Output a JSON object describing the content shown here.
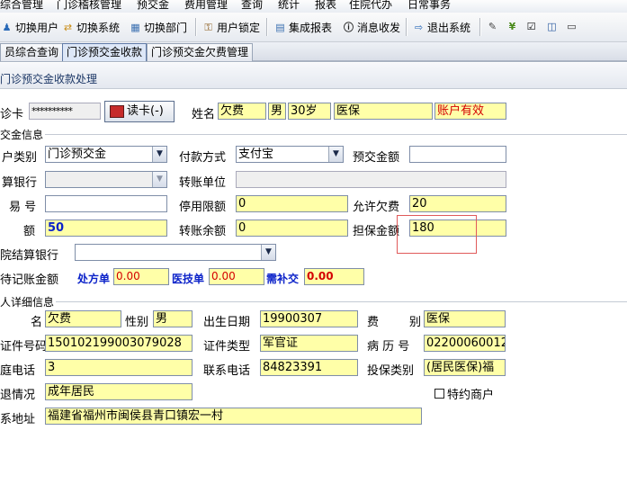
{
  "menubar": {
    "items": [
      "综合管理",
      "门诊稽核管理",
      "预交金",
      "费用管理",
      "查询",
      "统计",
      "报表",
      "住院代办",
      "日常事务"
    ]
  },
  "toolbar": {
    "switch_user": "切换用户",
    "switch_system": "切换系统",
    "switch_dept": "切换部门",
    "user_lock": "用户锁定",
    "integrated_report": "集成报表",
    "message": "消息收发",
    "exit_system": "退出系统"
  },
  "tabs": [
    "员综合查询",
    "门诊预交金收款",
    "门诊预交金欠费管理"
  ],
  "subheader": {
    "title": "门诊预交金收款处理"
  },
  "card": {
    "label": "诊卡",
    "card_no": "**********",
    "read_button": "读卡(-)",
    "name_label": "姓名",
    "name": "欠费",
    "gender": "男",
    "age": "30岁",
    "insurance": "医保",
    "account_status": "账户有效"
  },
  "payment": {
    "section_title": "交金信息",
    "account_type_label": "户类别",
    "account_type": "门诊预交金",
    "pay_method_label": "付款方式",
    "pay_method": "支付宝",
    "prepay_amount_label": "预交金额",
    "prepay_amount": "",
    "bank_label": "算银行",
    "bank": "",
    "transfer_unit_label": "转账单位",
    "transfer_unit": "",
    "trade_no_label": "易 号",
    "trade_no": "",
    "stop_limit_label": "停用限额",
    "stop_limit": "0",
    "allow_debt_label": "允许欠费",
    "allow_debt": "20",
    "amount_label": "额",
    "amount": "50",
    "transfer_balance_label": "转账余额",
    "transfer_balance": "0",
    "guarantee_label": "担保金额",
    "guarantee": "180",
    "hospital_bank_label": "院结算银行",
    "hospital_bank": "",
    "pending_label": "待记账金额",
    "rx_label": "处方单",
    "rx_value": "0.00",
    "tech_label": "医技单",
    "tech_value": "0.00",
    "supplement_label": "需补交",
    "supplement_value": "0.00"
  },
  "person": {
    "section_title": "人详细信息",
    "name_label": "名",
    "name": "欠费",
    "gender_label": "性别",
    "gender": "男",
    "birthday_label": "出生日期",
    "birthday": "19900307",
    "fee_label": "费",
    "fee_type_label": "别",
    "fee_type": "医保",
    "idno_label": "证件号码",
    "idno": "150102199003079028",
    "idtype_label": "证件类型",
    "idtype": "军官证",
    "record_label": "病 历 号",
    "record": "02200060012",
    "home_phone_label": "庭电话",
    "home_phone": "3",
    "contact_phone_label": "联系电话",
    "contact_phone": "84823391",
    "ins_type_label": "投保类别",
    "ins_type": "(居民医保)福",
    "retire_label": "退情况",
    "retire": "成年居民",
    "special_merchant": "特约商户",
    "address_label": "系地址",
    "address": "福建省福州市闽侯县青口镇宏一村"
  }
}
